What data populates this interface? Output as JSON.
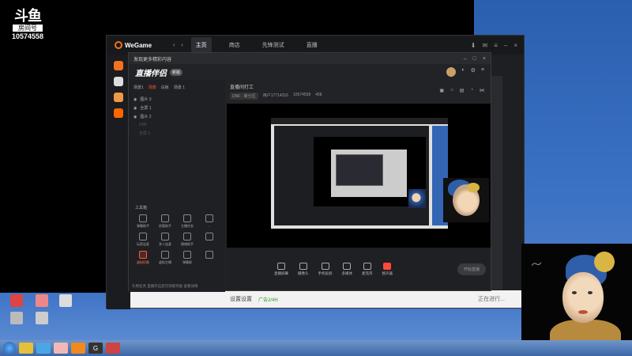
{
  "stream_logo": {
    "brand": "斗鱼",
    "room_label": "房间号",
    "room_number": "10574558"
  },
  "wegame": {
    "logo": "WeGame",
    "nav": [
      {
        "label": "主页",
        "active": true
      },
      {
        "label": "商店",
        "active": false
      },
      {
        "label": "先锋测试",
        "active": false
      },
      {
        "label": "直播",
        "active": false
      }
    ],
    "footer_left": "",
    "footer_mid": "设置设置",
    "footer_mid2": "广告2/4H",
    "footer_right": "正在进行..."
  },
  "live_companion": {
    "window_title": "发现更多精彩内容",
    "app_title": "直播伴侣",
    "version_badge": "新版",
    "scene_tabs": [
      "场景1",
      "场景",
      "白板",
      "场景 1"
    ],
    "scene_items": [
      {
        "label": "图片 3",
        "dim": false
      },
      {
        "label": "全屏 1",
        "dim": false
      },
      {
        "label": "图片 2",
        "dim": false
      },
      {
        "label": "DNF",
        "dim": true
      },
      {
        "label": "全屏 1",
        "dim": true
      }
    ],
    "tools_title": "工具箱",
    "tools": [
      {
        "label": "弹幕助手",
        "hot": false
      },
      {
        "label": "房管助手",
        "hot": false
      },
      {
        "label": "主播任务",
        "hot": false
      },
      {
        "label": "...",
        "hot": false
      },
      {
        "label": "玩家连麦",
        "hot": false
      },
      {
        "label": "多人连麦",
        "hot": false
      },
      {
        "label": "情绪助手",
        "hot": false
      },
      {
        "label": "",
        "hot": false
      },
      {
        "label": "虚拟形象",
        "hot": true
      },
      {
        "label": "虚拟主播",
        "hot": false
      },
      {
        "label": "弹幕姬",
        "hot": false
      },
      {
        "label": "",
        "hot": false
      }
    ],
    "notice": "礼物任务 直播开启后可领取奖励 查看详情",
    "stream_title": "直播间打工",
    "game_tag": "DNF · 新分区",
    "user_id": "用户17714316",
    "room_id": "10574558",
    "followers": "458",
    "controls": [
      "直播屏幕",
      "摄像头",
      "手机投屏",
      "多媒体",
      "麦克风",
      "扬声器"
    ],
    "start_label": "开始直播"
  },
  "colors": {
    "accent": "#ff5a3a",
    "wegame_orange": "#f4711f",
    "desktop_blue": "#3d73c4"
  }
}
